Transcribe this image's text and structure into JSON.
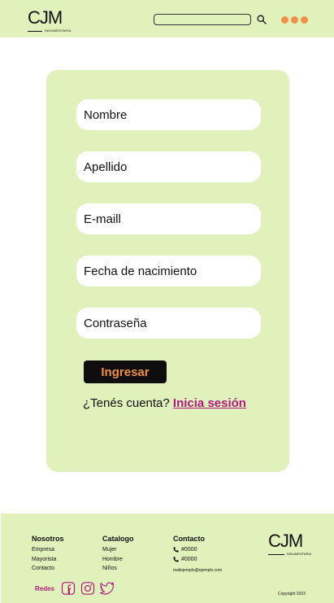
{
  "header": {
    "logo_text": "CJM",
    "logo_sub": "INDUMENTARIA",
    "search": {
      "value": "",
      "placeholder": ""
    },
    "icons": {
      "search": "search-icon",
      "menu": "menu-dots-icon"
    },
    "accent": "#f0914b"
  },
  "form": {
    "fields": [
      {
        "placeholder": "Nombre",
        "value": ""
      },
      {
        "placeholder": "Apellido",
        "value": ""
      },
      {
        "placeholder": "E-maill",
        "value": ""
      },
      {
        "placeholder": "Fecha de nacimiento",
        "value": ""
      },
      {
        "placeholder": "Contraseña",
        "value": ""
      }
    ],
    "submit_label": "Ingresar",
    "have_account_text": "¿Tenés cuenta?",
    "login_link_text": "Inicia sesión"
  },
  "footer": {
    "columns": [
      {
        "title": "Nosotros",
        "items": [
          "Empresa",
          "Mayorista",
          "Contacto"
        ]
      },
      {
        "title": "Catalogo",
        "items": [
          "Mujer",
          "Hombre",
          "Niños"
        ]
      },
      {
        "title": "Contacto",
        "phones": [
          "#0000",
          "#0000"
        ],
        "email": "mailejemplo@ejemplo.com"
      }
    ],
    "logo_text": "CJM",
    "logo_sub": "INDUMENTARIA",
    "social_label": "Redes",
    "social_icons": [
      "facebook-icon",
      "instagram-icon",
      "twitter-icon"
    ],
    "copyright": "Copyright 2023"
  },
  "colors": {
    "panel_green": "#e0f1bb",
    "link_magenta": "#b0197f",
    "button_dark": "#0f0d0e",
    "button_text_orange": "#f0914b"
  }
}
